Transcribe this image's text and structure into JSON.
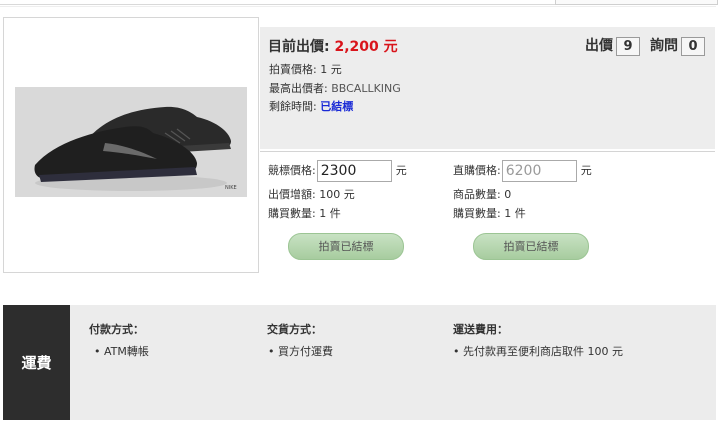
{
  "auction": {
    "current_bid_label": "目前出價:",
    "current_bid_value": "2,200 元",
    "bid_count_label": "出價",
    "bid_count": "9",
    "question_count_label": "詢問",
    "question_count": "0",
    "auction_price_label": "拍賣價格:",
    "auction_price_value": "1 元",
    "highest_bidder_label": "最高出價者:",
    "highest_bidder_value": "BBCALLKING",
    "time_left_label": "剩餘時間:",
    "time_left_value": "已結標"
  },
  "bid_form": {
    "bid_price_label": "競標價格:",
    "bid_price_value": "2300",
    "bid_price_unit": "元",
    "bid_increment_label": "出價增額:",
    "bid_increment_value": "100 元",
    "bid_quantity_label": "購買數量:",
    "bid_quantity_value": "1 件",
    "bid_button_label": "拍賣已結標"
  },
  "buy_form": {
    "buy_price_label": "直購價格:",
    "buy_price_value": "6200",
    "buy_price_unit": "元",
    "stock_label": "商品數量:",
    "stock_value": "0",
    "buy_quantity_label": "購買數量:",
    "buy_quantity_value": "1 件",
    "buy_button_label": "拍賣已結標"
  },
  "shipping": {
    "section_label": "運費",
    "payment_title": "付款方式：",
    "payment_item": "• ATM轉帳",
    "delivery_title": "交貨方式：",
    "delivery_item": "• 買方付運費",
    "fee_title": "運送費用：",
    "fee_item": "• 先付款再至便利商店取件 100 元"
  },
  "product": {
    "image_icon": "running-shoe-image"
  },
  "colors": {
    "price_red": "#d9141b",
    "status_blue": "#1a2ad6",
    "button_green": "#b3d6ac",
    "shipping_dark": "#2d2d2d"
  }
}
